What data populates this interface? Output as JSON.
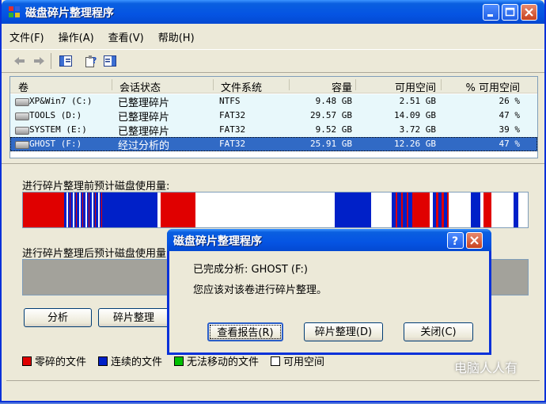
{
  "window": {
    "title": "磁盘碎片整理程序"
  },
  "menu": [
    "文件(F)",
    "操作(A)",
    "查看(V)",
    "帮助(H)"
  ],
  "volumes": {
    "headers": [
      "卷",
      "会话状态",
      "文件系统",
      "容量",
      "可用空间",
      "% 可用空间"
    ],
    "rows": [
      {
        "volume": "XP&Win7 (C:)",
        "status": "已整理碎片",
        "fs": "NTFS",
        "capacity": "9.48 GB",
        "free": "2.51 GB",
        "pct": "26 %"
      },
      {
        "volume": "TOOLS (D:)",
        "status": "已整理碎片",
        "fs": "FAT32",
        "capacity": "29.57 GB",
        "free": "14.09 GB",
        "pct": "47 %"
      },
      {
        "volume": "SYSTEM (E:)",
        "status": "已整理碎片",
        "fs": "FAT32",
        "capacity": "9.52 GB",
        "free": "3.72 GB",
        "pct": "39 %"
      },
      {
        "volume": "GHOST (F:)",
        "status": "经过分析的",
        "fs": "FAT32",
        "capacity": "25.91 GB",
        "free": "12.26 GB",
        "pct": "47 %"
      }
    ]
  },
  "before_label": "进行碎片整理前预计磁盘使用量:",
  "after_label": "进行碎片整理后预计磁盘使用量:",
  "buttons": {
    "analyze": "分析",
    "defrag": "碎片整理"
  },
  "legend": {
    "fragmented": "零碎的文件",
    "contiguous": "连续的文件",
    "unmovable": "无法移动的文件",
    "free": "可用空间"
  },
  "colors": {
    "fragmented": "#e00000",
    "contiguous": "#0020c8",
    "unmovable": "#00c000",
    "free": "#ffffff"
  },
  "dialog": {
    "title": "磁盘碎片整理程序",
    "line1": "已完成分析: GHOST (F:)",
    "line2": "您应该对该卷进行碎片整理。",
    "view_report": "查看报告(R)",
    "defrag": "碎片整理(D)",
    "close": "关闭(C)"
  },
  "watermark": "电脑人人有"
}
